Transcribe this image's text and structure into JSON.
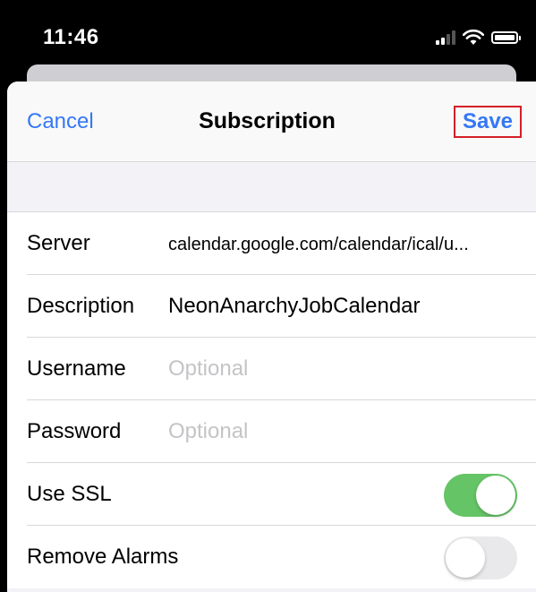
{
  "status_bar": {
    "time": "11:46",
    "signal_icon": "cellular-signal-icon",
    "wifi_icon": "wifi-icon",
    "battery_icon": "battery-icon"
  },
  "nav": {
    "cancel_label": "Cancel",
    "title": "Subscription",
    "save_label": "Save"
  },
  "form": {
    "server": {
      "label": "Server",
      "value": "calendar.google.com/calendar/ical/u..."
    },
    "description": {
      "label": "Description",
      "value": "NeonAnarchyJobCalendar"
    },
    "username": {
      "label": "Username",
      "value": "",
      "placeholder": "Optional"
    },
    "password": {
      "label": "Password",
      "value": "",
      "placeholder": "Optional"
    },
    "use_ssl": {
      "label": "Use SSL",
      "on": true
    },
    "remove_alarms": {
      "label": "Remove Alarms",
      "on": false
    }
  },
  "colors": {
    "accent": "#3478f6",
    "toggle_on": "#65c466",
    "toggle_off": "#e9e9eb",
    "highlight_border": "#d42027"
  }
}
